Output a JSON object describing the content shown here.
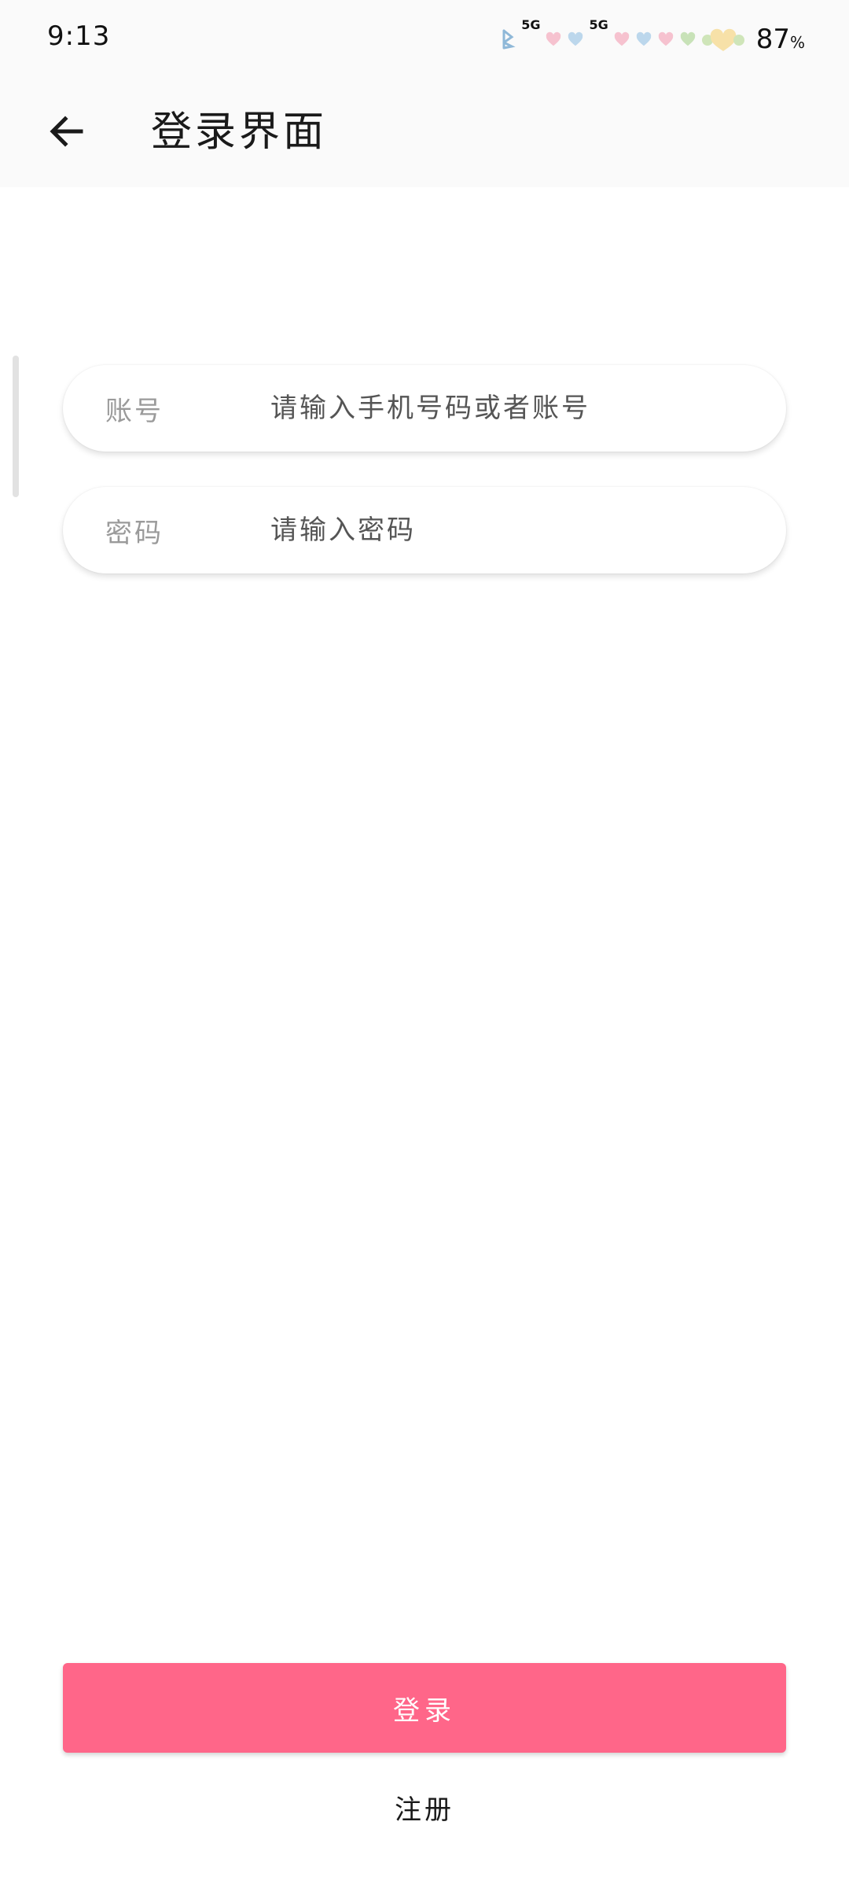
{
  "status_bar": {
    "time": "9:13",
    "network_1": "5G",
    "network_2": "5G",
    "battery_value": "87",
    "battery_unit": "%",
    "decorations": [
      "heart-icon",
      "heart-icon",
      "heart-icon",
      "heart-icon",
      "heart-icon",
      "heart-icon"
    ]
  },
  "app_bar": {
    "back_icon": "arrow-left-icon",
    "title": "登录界面"
  },
  "form": {
    "account": {
      "label": "账号",
      "placeholder": "请输入手机号码或者账号"
    },
    "password": {
      "label": "密码",
      "placeholder": "请输入密码"
    }
  },
  "actions": {
    "login_label": "登录",
    "register_label": "注册"
  },
  "colors": {
    "accent": "#ff6689",
    "bar_background": "#fafafa"
  }
}
